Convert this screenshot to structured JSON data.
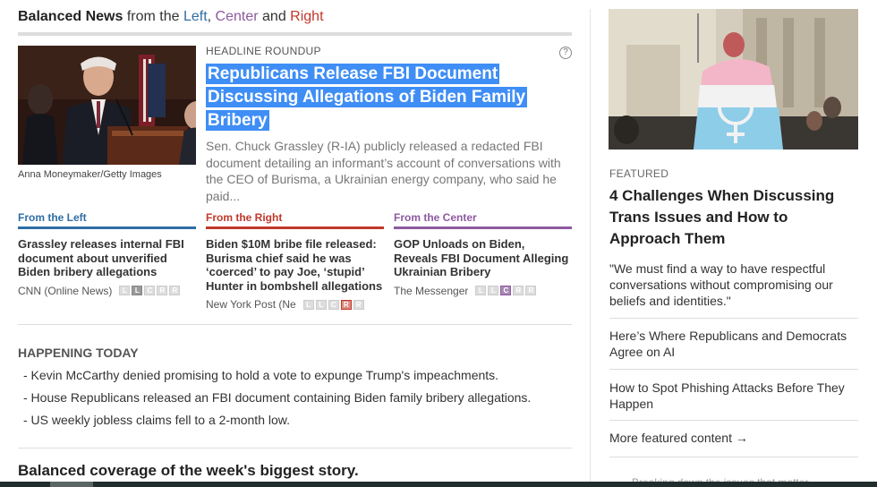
{
  "brand": {
    "bold": "Balanced News",
    "mid": " from the ",
    "left": "Left",
    "comma": ", ",
    "center": "Center",
    "and": " and ",
    "right": "Right"
  },
  "headline": {
    "kicker": "HEADLINE ROUNDUP",
    "help": "?",
    "title": "Republicans Release FBI Document Discussing Allegations of Biden Family Bribery",
    "summary": "Sen. Chuck Grassley (R-IA) publicly released a redacted FBI document detailing an informant’s account of conversations with the CEO of Burisma, a Ukrainian energy company, who said he paid...",
    "image_credit": "Anna Moneymaker/Getty Images"
  },
  "perspectives": [
    {
      "label": "From the Left",
      "color": "#2f6ea5",
      "title": "Grassley releases internal FBI document about unverified Biden bribery allegations",
      "source": "CNN (Online News)",
      "bias": [
        "L",
        "L",
        "C",
        "R",
        "R"
      ],
      "active": 1
    },
    {
      "label": "From the Right",
      "color": "#c0392b",
      "title": "Biden $10M bribe file released: Burisma chief said he was ‘coerced’ to pay Joe, ‘stupid’ Hunter in bombshell allegations",
      "source": "New York Post (Ne",
      "bias": [
        "L",
        "L",
        "C",
        "R",
        "R"
      ],
      "active": 3
    },
    {
      "label": "From the Center",
      "color": "#8e5aa0",
      "title": "GOP Unloads on Biden, Reveals FBI Document Alleging Ukrainian Bribery",
      "source": "The Messenger",
      "bias": [
        "L",
        "L",
        "C",
        "R",
        "R"
      ],
      "active": 2
    }
  ],
  "happening": {
    "heading": "HAPPENING TODAY",
    "items": [
      "- Kevin McCarthy denied promising to hold a vote to expunge Trump's impeachments.",
      "- House Republicans released an FBI document containing Biden family bribery allegations.",
      "- US weekly jobless claims fell to a 2-month low."
    ]
  },
  "balanced_heading": "Balanced coverage of the week's biggest story.",
  "sidebar": {
    "kicker": "FEATURED",
    "title": "4 Challenges When Discussing Trans Issues and How to Approach Them",
    "quote": "\"We must find a way to have respectful conversations without compromising our beliefs and identities.\"",
    "links": [
      "Here’s Where Republicans and Democrats Agree on AI",
      "How to Spot Phishing Attacks Before They Happen"
    ],
    "more": "More featured content →",
    "cutoff": "Breaking down the issues that matter"
  }
}
